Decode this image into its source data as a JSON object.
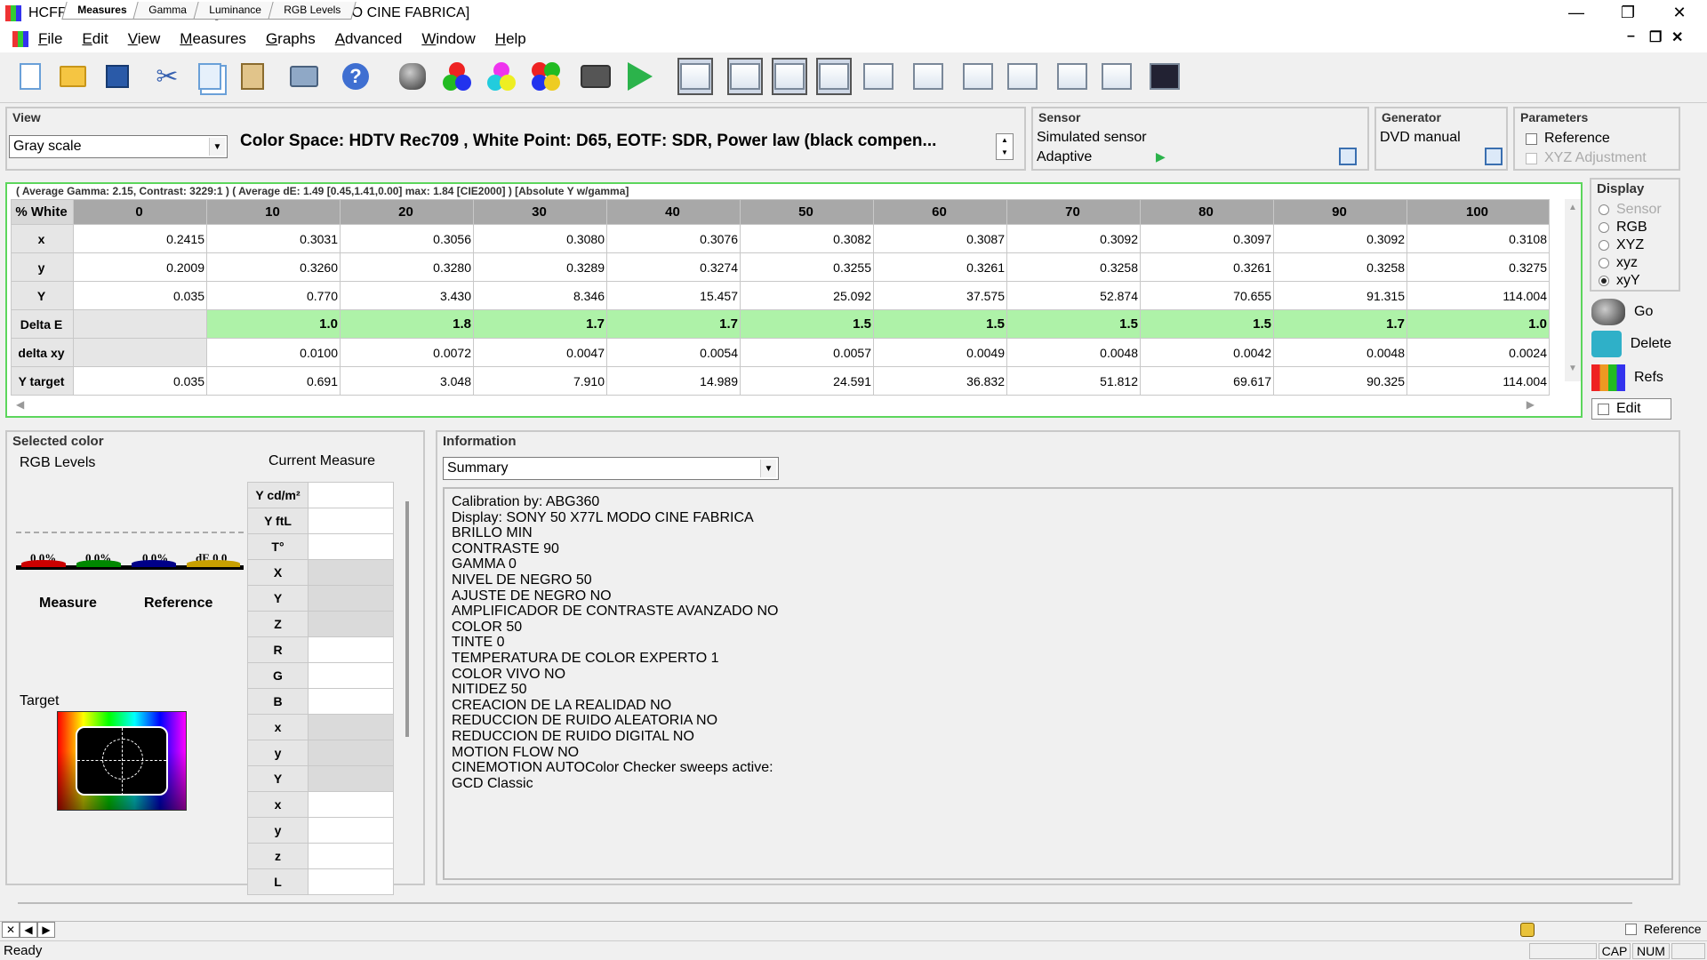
{
  "window": {
    "title": "HCFR Colorimeter - 3.5.1.4 - [SONY 50 X77L MODO CINE FABRICA]",
    "minimize": "—",
    "restore": "❐",
    "close": "✕"
  },
  "menu": [
    "File",
    "Edit",
    "View",
    "Measures",
    "Graphs",
    "Advanced",
    "Window",
    "Help"
  ],
  "mdi": {
    "minimize": "–",
    "restore": "❐",
    "close": "✕"
  },
  "view": {
    "title": "View",
    "mode": "Gray scale",
    "colorspace": "Color Space: HDTV Rec709 , White Point: D65, EOTF:  SDR, Power law (black compen..."
  },
  "sensor": {
    "title": "Sensor",
    "name": "Simulated sensor",
    "mode": "Adaptive"
  },
  "generator": {
    "title": "Generator",
    "name": "DVD manual"
  },
  "parameters": {
    "title": "Parameters",
    "reference": "Reference",
    "xyz_adjustment": "XYZ Adjustment"
  },
  "grid": {
    "summary": "( Average Gamma: 2.15, Contrast: 3229:1 ) ( Average dE: 1.49 [0.45,1.41,0.00] max: 1.84 [CIE2000] ) [Absolute Y w/gamma]",
    "corner": "% White",
    "columns": [
      "0",
      "10",
      "20",
      "30",
      "40",
      "50",
      "60",
      "70",
      "80",
      "90",
      "100"
    ],
    "rows": [
      {
        "label": "x",
        "values": [
          "0.2415",
          "0.3031",
          "0.3056",
          "0.3080",
          "0.3076",
          "0.3082",
          "0.3087",
          "0.3092",
          "0.3097",
          "0.3092",
          "0.3108"
        ]
      },
      {
        "label": "y",
        "values": [
          "0.2009",
          "0.3260",
          "0.3280",
          "0.3289",
          "0.3274",
          "0.3255",
          "0.3261",
          "0.3258",
          "0.3261",
          "0.3258",
          "0.3275"
        ]
      },
      {
        "label": "Y",
        "values": [
          "0.035",
          "0.770",
          "3.430",
          "8.346",
          "15.457",
          "25.092",
          "37.575",
          "52.874",
          "70.655",
          "91.315",
          "114.004"
        ]
      },
      {
        "label": "Delta E",
        "values": [
          "",
          "1.0",
          "1.8",
          "1.7",
          "1.7",
          "1.5",
          "1.5",
          "1.5",
          "1.5",
          "1.7",
          "1.0"
        ]
      },
      {
        "label": "delta xy",
        "values": [
          "",
          "0.0100",
          "0.0072",
          "0.0047",
          "0.0054",
          "0.0057",
          "0.0049",
          "0.0048",
          "0.0042",
          "0.0048",
          "0.0024"
        ]
      },
      {
        "label": "Y target",
        "values": [
          "0.035",
          "0.691",
          "3.048",
          "7.910",
          "14.989",
          "24.591",
          "36.832",
          "51.812",
          "69.617",
          "90.325",
          "114.004"
        ]
      }
    ]
  },
  "display": {
    "title": "Display",
    "options": [
      "Sensor",
      "RGB",
      "XYZ",
      "xyz",
      "xyY"
    ],
    "selected": "xyY",
    "go": "Go",
    "delete": "Delete",
    "refs": "Refs",
    "edit": "Edit"
  },
  "selected_color": {
    "title": "Selected color",
    "rgb_levels": "RGB Levels",
    "current_measure": "Current Measure",
    "r": "0.0%",
    "g": "0.0%",
    "b": "0.0%",
    "de": "dE 0.0",
    "measure": "Measure",
    "reference": "Reference",
    "target": "Target",
    "measure_rows": [
      "Y cd/m²",
      "Y ftL",
      "T°",
      "X",
      "Y",
      "Z",
      "R",
      "G",
      "B",
      "x",
      "y",
      "Y",
      "x",
      "y",
      "z",
      "L"
    ]
  },
  "information": {
    "title": "Information",
    "mode": "Summary",
    "lines": [
      "Calibration by: ABG360",
      "Display: SONY 50 X77L MODO CINE FABRICA",
      "BRILLO MIN",
      "CONTRASTE 90",
      "GAMMA 0",
      "NIVEL DE NEGRO 50",
      "AJUSTE DE NEGRO NO",
      "AMPLIFICADOR DE CONTRASTE AVANZADO NO",
      "COLOR 50",
      "TINTE 0",
      "TEMPERATURA DE COLOR EXPERTO 1",
      "COLOR VIVO NO",
      "NITIDEZ 50",
      "CREACION DE LA REALIDAD NO",
      "REDUCCION DE RUIDO ALEATORIA NO",
      "REDUCCION DE RUIDO DIGITAL NO",
      "MOTION FLOW NO",
      "CINEMOTION AUTOColor Checker sweeps active:",
      "GCD Classic"
    ]
  },
  "tabs": [
    "Measures",
    "Gamma",
    "Luminance",
    "RGB Levels"
  ],
  "active_tab": "Measures",
  "tab_nav": [
    "✕",
    "◀",
    "▶"
  ],
  "bottom_reference": "Reference",
  "status": {
    "text": "Ready",
    "cap": "CAP",
    "num": "NUM"
  },
  "colors": {
    "accent_green": "#5cd65c",
    "delta_e_fill": "#aef2a8",
    "header_gray": "#a8a8a8"
  }
}
